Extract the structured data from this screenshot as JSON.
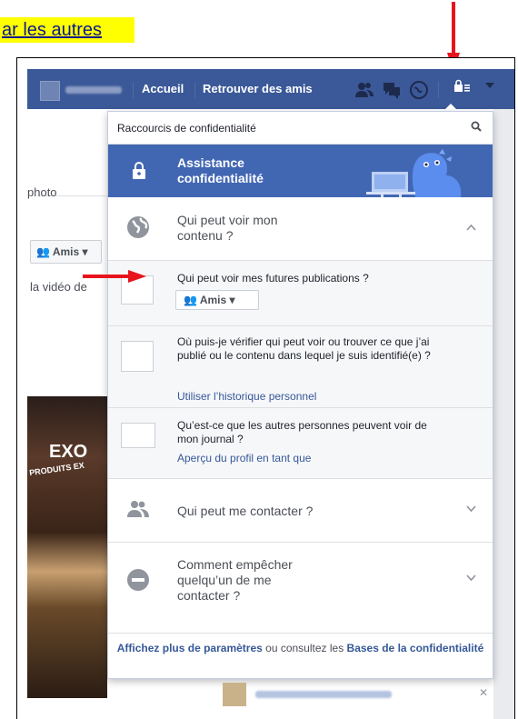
{
  "doc": {
    "heading": "ar les autres"
  },
  "topbar": {
    "home": "Accueil",
    "find_friends": "Retrouver des amis"
  },
  "background": {
    "photo_label": "photo",
    "amis_button": "Amis",
    "video_text": "la vidéo de",
    "sign_text_1": "EXO",
    "sign_text_2": "PRODUITS EX"
  },
  "panel": {
    "header": "Raccourcis de confidentialité",
    "assist_title": "Assistance confidentialité",
    "row1_title": "Qui peut voir mon contenu ?",
    "sub1_question": "Qui peut voir mes futures publications ?",
    "sub1_select": "Amis",
    "sub2_question": "Où puis-je vérifier qui peut voir ou trouver ce que j’ai publié ou le contenu dans lequel je suis identifié(e) ?",
    "sub2_link": "Utiliser l’historique personnel",
    "sub3_question": "Qu’est-ce que les autres personnes peuvent voir de mon journal ?",
    "sub3_link": "Aperçu du profil en tant que",
    "row2_title": "Qui peut me contacter ?",
    "row3_title": "Comment empêcher quelqu’un de me contacter ?",
    "footer_link1": "Affichez plus de paramètres",
    "footer_mid": " ou consultez les ",
    "footer_link2": "Bases de la confidentialité"
  },
  "colors": {
    "brand": "#3b5998",
    "assist": "#4267b2",
    "arrow": "#e8141c",
    "highlight": "#ffff00"
  },
  "icons": [
    "lock-icon",
    "globe-icon",
    "friends-icon",
    "messages-icon",
    "notifications-icon",
    "search-icon",
    "block-icon",
    "chevron-up-icon",
    "chevron-down-icon"
  ]
}
